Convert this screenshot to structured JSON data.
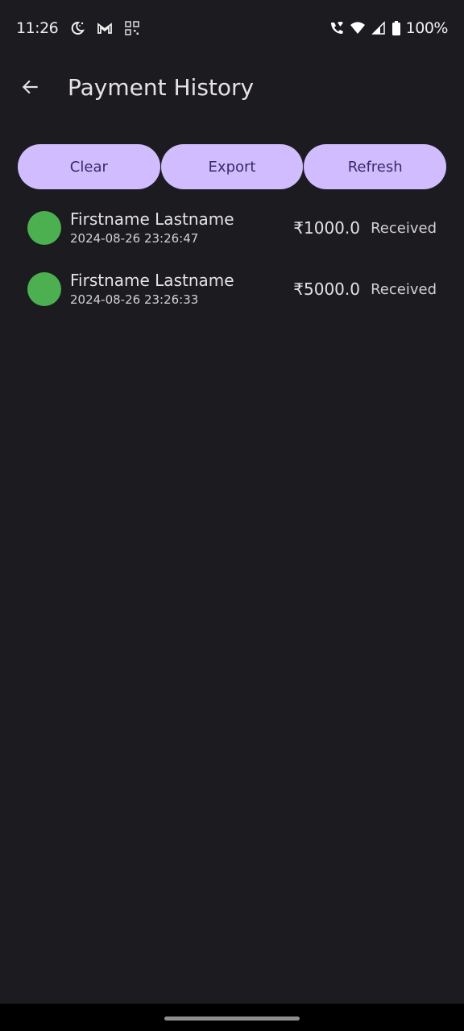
{
  "status_bar": {
    "time": "11:26",
    "left_icons": [
      "moon-icon",
      "gmail-icon",
      "qr-code-icon"
    ],
    "right_icons": [
      "wifi-calling-icon",
      "wifi-icon",
      "signal-icon",
      "battery-icon"
    ],
    "battery": "100%"
  },
  "app_bar": {
    "back_icon": "arrow-left-icon",
    "title": "Payment History"
  },
  "actions": {
    "clear_label": "Clear",
    "export_label": "Export",
    "refresh_label": "Refresh"
  },
  "colors": {
    "background": "#1c1b20",
    "button": "#d0bcfe",
    "button_text": "#3a2a6a",
    "status_dot": "#4caf50"
  },
  "payments": [
    {
      "name": "Firstname Lastname",
      "datetime": "2024-08-26 23:26:47",
      "amount": "₹1000.0",
      "status": "Received"
    },
    {
      "name": "Firstname Lastname",
      "datetime": "2024-08-26 23:26:33",
      "amount": "₹5000.0",
      "status": "Received"
    }
  ]
}
